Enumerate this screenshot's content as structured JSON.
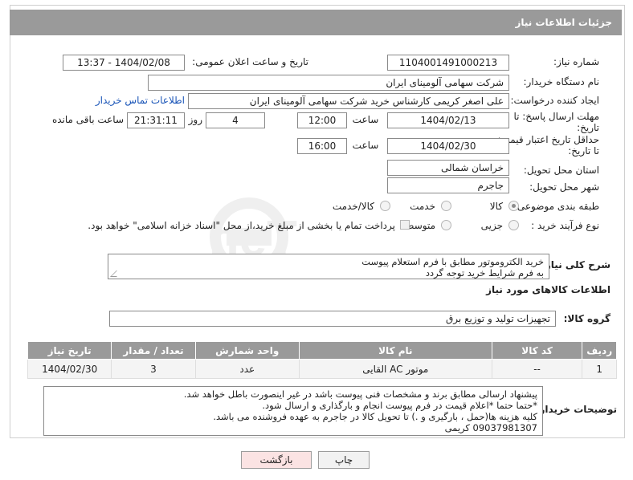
{
  "page": {
    "title": "جزئیات اطلاعات نیاز"
  },
  "need": {
    "number_label": "شماره نیاز:",
    "number": "1104001491000213",
    "announce_label": "تاریخ و ساعت اعلان عمومی:",
    "announce_value": "1404/02/08 - 13:37"
  },
  "buyer": {
    "org_label": "نام دستگاه خریدار:",
    "org": "شرکت سهامی آلومینای ایران",
    "creator_label": "ایجاد کننده درخواست:",
    "creator": "علی اصغر کریمی کارشناس خرید شرکت سهامی آلومینای ایران",
    "contact_link": "اطلاعات تماس خریدار"
  },
  "deadline": {
    "label_line1": "مهلت ارسال پاسخ: تا",
    "label_line2": "تاریخ:",
    "date": "1404/02/13",
    "time_label": "ساعت",
    "time": "12:00",
    "days": "4",
    "days_label": "روز و",
    "remaining": "21:31:11",
    "remaining_label": "ساعت باقی مانده"
  },
  "validity": {
    "label_line1": "حداقل تاریخ اعتبار قیمت:",
    "label_line2": "تا تاریخ:",
    "date": "1404/02/30",
    "time_label": "ساعت",
    "time": "16:00"
  },
  "delivery": {
    "province_label": "استان محل تحویل:",
    "province": "خراسان شمالی",
    "city_label": "شهر محل تحویل:",
    "city": "جاجرم"
  },
  "category": {
    "label": "طبقه بندی موضوعی:",
    "options": [
      "کالا",
      "خدمت",
      "کالا/خدمت"
    ]
  },
  "purchase": {
    "label": "نوع فرآیند خرید :",
    "options": [
      "جزیی",
      "متوسط"
    ],
    "treasury_note": "پرداخت تمام یا بخشی از مبلغ خرید،از محل \"اسناد خزانه اسلامی\" خواهد بود."
  },
  "description": {
    "label": "شرح کلی نیاز:",
    "line1": "خرید الکتروموتور مطابق با فرم استعلام پیوست",
    "line2": "به فرم شرایط خرید توجه گردد"
  },
  "goods": {
    "section_title": "اطلاعات کالاهای مورد نیاز",
    "group_label": "گروه کالا:",
    "group": "تجهیزات تولید و توزیع برق",
    "headers": [
      "ردیف",
      "کد کالا",
      "نام کالا",
      "واحد شمارش",
      "تعداد / مقدار",
      "تاریخ نیاز"
    ],
    "rows": [
      {
        "row": "1",
        "code": "--",
        "name": "موتور AC القایی",
        "unit": "عدد",
        "qty": "3",
        "date": "1404/02/30"
      }
    ]
  },
  "notes": {
    "label": "توضیحات خریدار:",
    "lines": [
      "پیشنهاد ارسالی مطابق برند و مشخصات فنی پیوست باشد در غیر اینصورت باطل خواهد شد.",
      "*حتما حتما *اعلام قیمت در فرم پیوست انجام و بارگذاری و ارسال شود.",
      "کلیه هزینه ها(حمل ، بارگیری و .) تا تحویل کالا در جاجرم به عهده فروشنده می باشد.",
      "09037981307 کریمی"
    ]
  },
  "actions": {
    "print": "چاپ",
    "back": "بازگشت"
  },
  "watermark": {
    "text": "AriaTender.neT"
  }
}
